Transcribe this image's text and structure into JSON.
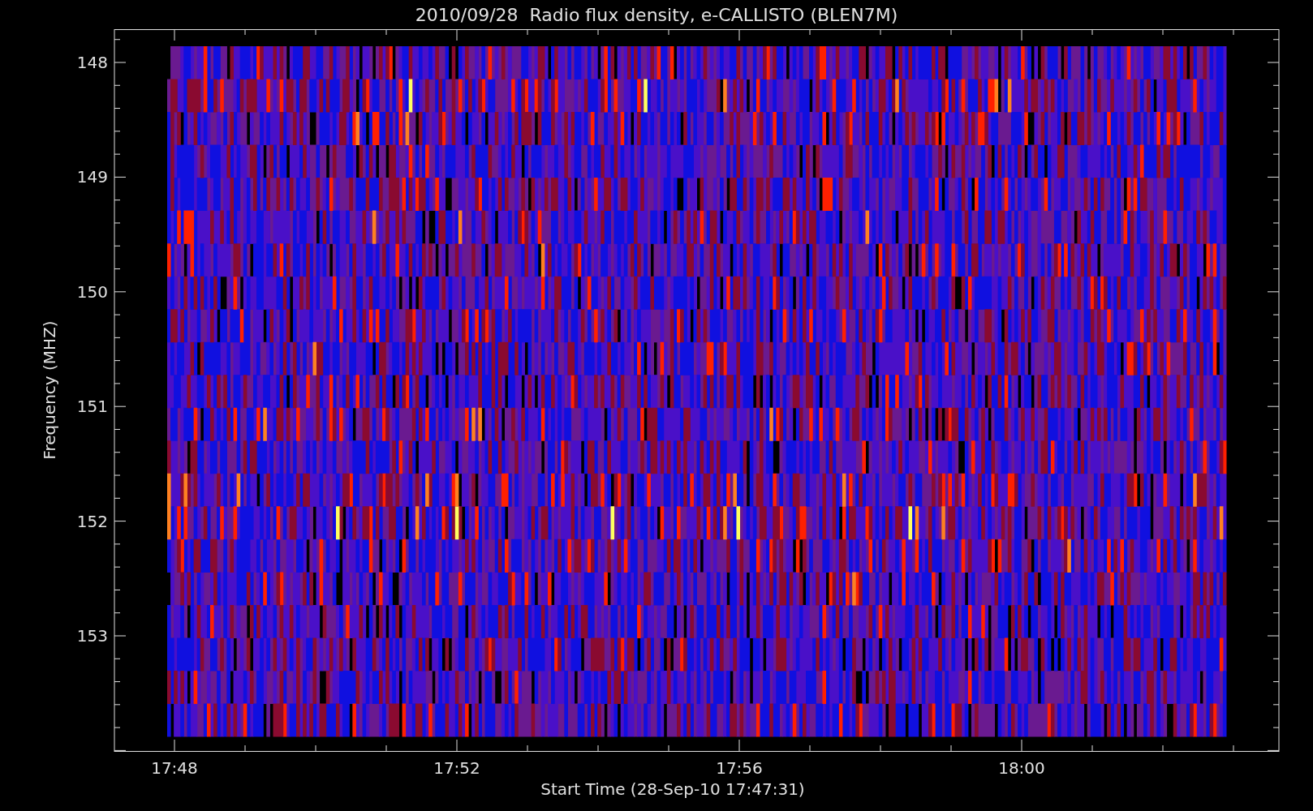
{
  "title": "2010/09/28  Radio flux density, e-CALLISTO (BLEN7M)",
  "y_axis": {
    "label": "Frequency (MHZ)",
    "ticks": [
      "148",
      "149",
      "150",
      "151",
      "152",
      "153"
    ]
  },
  "x_axis": {
    "label": "Start Time (28-Sep-10 17:47:31)",
    "ticks": [
      "17:48",
      "17:52",
      "17:56",
      "18:00"
    ]
  }
}
